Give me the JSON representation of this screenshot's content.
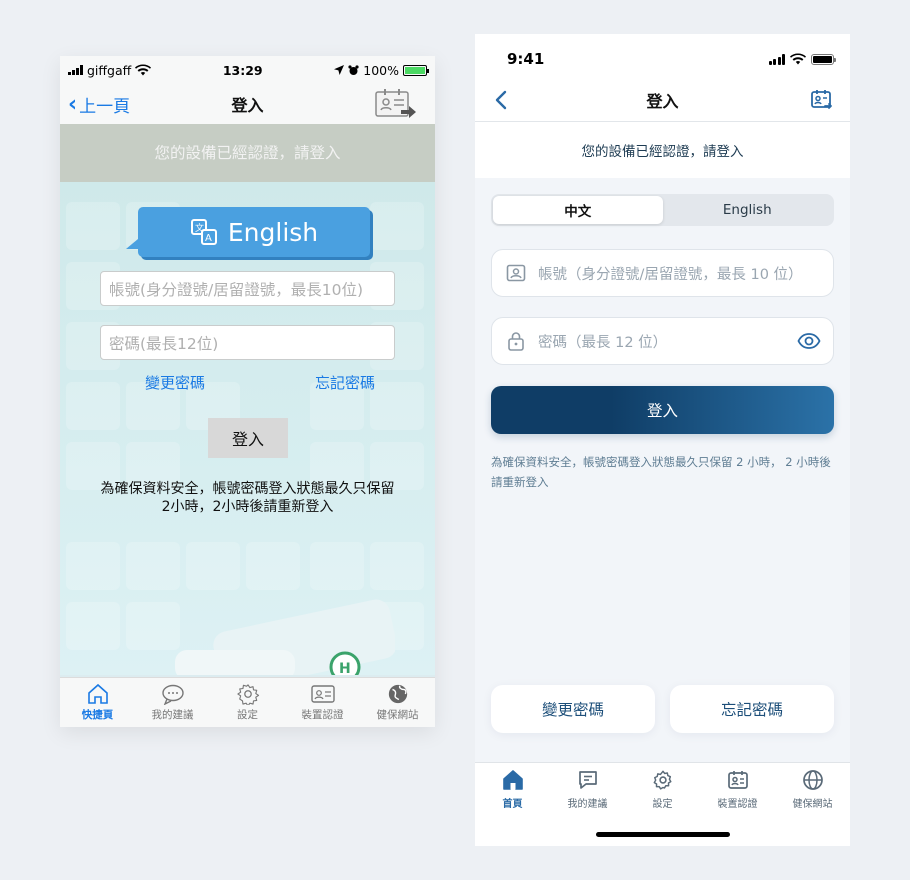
{
  "old_app": {
    "status": {
      "carrier": "giffgaff",
      "time": "13:29",
      "battery": "100%"
    },
    "nav": {
      "back_label": "上一頁",
      "title": "登入"
    },
    "banner": "您的設備已經認證，請登入",
    "language_button": "English",
    "account_placeholder": "帳號(身分證號/居留證號，最長10位)",
    "password_placeholder": "密碼(最長12位)",
    "change_password": "變更密碼",
    "forgot_password": "忘記密碼",
    "login_button": "登入",
    "note": "為確保資料安全，帳號密碼登入狀態最久只保留2小時，2小時後請重新登入",
    "tabs": [
      {
        "label": "快捷頁",
        "icon": "house-icon"
      },
      {
        "label": "我的建議",
        "icon": "chat-bubble-icon"
      },
      {
        "label": "設定",
        "icon": "gear-icon"
      },
      {
        "label": "裝置認證",
        "icon": "id-card-icon"
      },
      {
        "label": "健保網站",
        "icon": "globe-icon"
      }
    ],
    "accent_color": "#1a7ae4"
  },
  "new_app": {
    "status": {
      "time": "9:41"
    },
    "nav": {
      "title": "登入"
    },
    "banner": "您的設備已經認證，請登入",
    "segment": [
      {
        "label": "中文",
        "selected": true
      },
      {
        "label": "English",
        "selected": false
      }
    ],
    "account_placeholder": "帳號（身分證號/居留證號，最長 10 位）",
    "password_placeholder": "密碼（最長 12 位）",
    "login_button": "登入",
    "note": "為確保資料安全，帳號密碼登入狀態最久只保留 2 小時， 2 小時後請重新登入",
    "change_password": "變更密碼",
    "forgot_password": "忘記密碼",
    "tabs": [
      {
        "label": "首頁",
        "icon": "house-icon"
      },
      {
        "label": "我的建議",
        "icon": "chat-bubble-icon"
      },
      {
        "label": "設定",
        "icon": "gear-icon"
      },
      {
        "label": "裝置認證",
        "icon": "id-card-icon"
      },
      {
        "label": "健保網站",
        "icon": "globe-icon"
      }
    ],
    "accent_color": "#2a6aa6",
    "primary_color": "#0f3d66"
  }
}
